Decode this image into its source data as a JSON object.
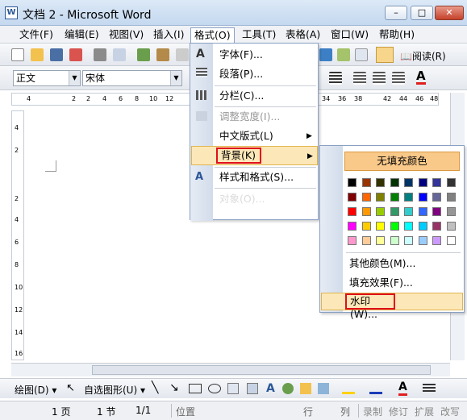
{
  "window": {
    "title": "文档 2 - Microsoft Word",
    "icon_label": "W",
    "min": "–",
    "max": "□",
    "close": "✕"
  },
  "menubar": [
    "文件(F)",
    "编辑(E)",
    "视图(V)",
    "插入(I)",
    "格式(O)",
    "工具(T)",
    "表格(A)",
    "窗口(W)",
    "帮助(H)"
  ],
  "toolbar": {
    "read_label": "阅读(R)",
    "style_value": "正文",
    "font_value": "宋体"
  },
  "ruler_ticks": [
    "4",
    "2",
    "2",
    "4",
    "6",
    "8",
    "10",
    "12",
    "34",
    "36",
    "38",
    "42",
    "44",
    "46",
    "48"
  ],
  "vruler_ticks": [
    "4",
    "2",
    "2",
    "4",
    "6",
    "8",
    "10",
    "12",
    "14",
    "16"
  ],
  "format_menu": {
    "items": [
      "字体(F)...",
      "段落(P)...",
      "分栏(C)...",
      "调整宽度(I)...",
      "中文版式(L)",
      "背景(K)",
      "样式和格式(S)...",
      "对象(O)..."
    ]
  },
  "background_menu": {
    "no_fill": "无填充颜色",
    "more_colors": "其他颜色(M)...",
    "fill_effects": "填充效果(F)...",
    "watermark": "水印(W)..."
  },
  "swatches": [
    "#000000",
    "#993300",
    "#333300",
    "#003300",
    "#003366",
    "#000080",
    "#333399",
    "#333333",
    "#800000",
    "#ff6600",
    "#808000",
    "#008000",
    "#008080",
    "#0000ff",
    "#666699",
    "#808080",
    "#ff0000",
    "#ff9900",
    "#99cc00",
    "#339966",
    "#33cccc",
    "#3366ff",
    "#800080",
    "#969696",
    "#ff00ff",
    "#ffcc00",
    "#ffff00",
    "#00ff00",
    "#00ffff",
    "#00ccff",
    "#993366",
    "#c0c0c0",
    "#ff99cc",
    "#ffcc99",
    "#ffff99",
    "#ccffcc",
    "#ccffff",
    "#99ccff",
    "#cc99ff",
    "#ffffff"
  ],
  "drawbar": {
    "draw_label": "绘图(D)",
    "autoshape_label": "自选图形(U)"
  },
  "status": {
    "page": "1 页",
    "section": "1 节",
    "pages": "1/1",
    "position": "位置",
    "line": "行",
    "col": "列",
    "rec": "录制",
    "trk": "修订",
    "ext": "扩展",
    "ovr": "改写"
  }
}
